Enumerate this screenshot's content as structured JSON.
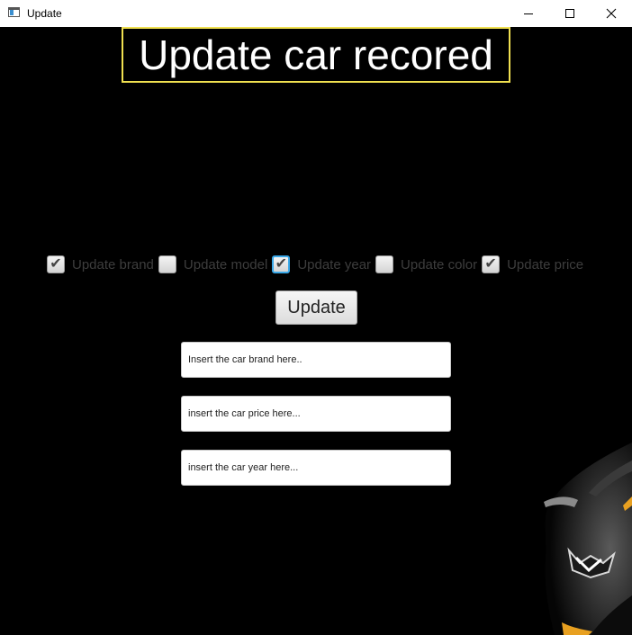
{
  "window": {
    "title": "Update",
    "icon": "app-window-icon",
    "controls": [
      "minimize-icon",
      "maximize-icon",
      "close-icon"
    ]
  },
  "heading": {
    "text": "Update car recored",
    "border_color": "#f0e050"
  },
  "checkboxes": [
    {
      "label": "Update brand",
      "checked": true
    },
    {
      "label": "Update model",
      "checked": false
    },
    {
      "label": "Update year",
      "checked": true,
      "focused": true
    },
    {
      "label": "Update color",
      "checked": false
    },
    {
      "label": "Update price",
      "checked": true
    }
  ],
  "update_button": {
    "label": "Update"
  },
  "fields": {
    "brand": {
      "placeholder": "Insert the car brand here..",
      "value": ""
    },
    "price": {
      "placeholder": "insert the car price here...",
      "value": ""
    },
    "year": {
      "placeholder": "insert the car year here...",
      "value": ""
    }
  },
  "colors": {
    "background": "#000000",
    "label": "#3d3d3d",
    "focus": "#3aa8e8",
    "car_accent": "#e8a020"
  }
}
